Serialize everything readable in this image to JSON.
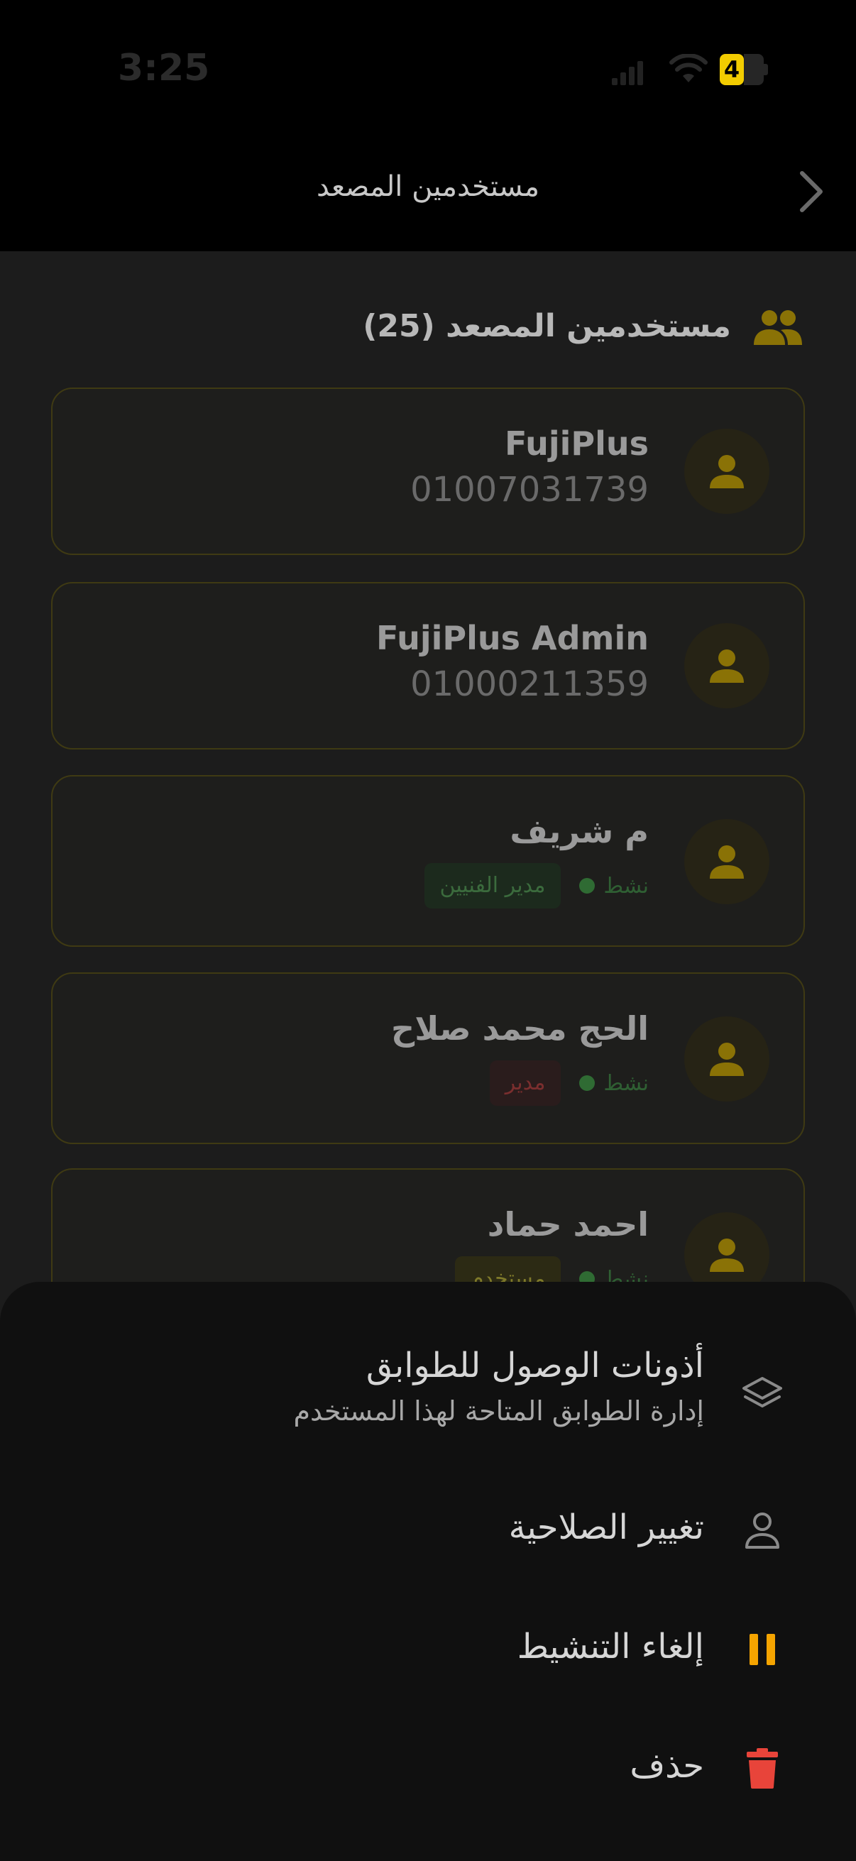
{
  "status_bar": {
    "time": "3:25",
    "battery": "4"
  },
  "nav": {
    "title": "مستخدمين المصعد"
  },
  "section": {
    "title": "مستخدمين المصعد (25)"
  },
  "users": [
    {
      "name": "FujiPlus",
      "phone": "01007031739"
    },
    {
      "name": "FujiPlus Admin",
      "phone": "01000211359"
    },
    {
      "name": "م شريف",
      "role": "مدير الفنيين",
      "status": "نشط"
    },
    {
      "name": "الحج محمد صلاح",
      "role": "مدير",
      "status": "نشط"
    },
    {
      "name": "احمد حماد",
      "role": "مستخدم",
      "status": "نشط"
    }
  ],
  "sheet": {
    "items": [
      {
        "label": "أذونات الوصول للطوابق",
        "sub": "إدارة الطوابق المتاحة لهذا المستخدم",
        "icon": "layers-icon"
      },
      {
        "label": "تغيير الصلاحية",
        "icon": "person-outline-icon"
      },
      {
        "label": "إلغاء التنشيط",
        "icon": "pause-icon"
      },
      {
        "label": "حذف",
        "icon": "trash-icon"
      }
    ]
  },
  "colors": {
    "accent": "#d4a800",
    "pause": "#f5a400",
    "delete": "#e8443a",
    "active_green": "#2f6b33"
  }
}
